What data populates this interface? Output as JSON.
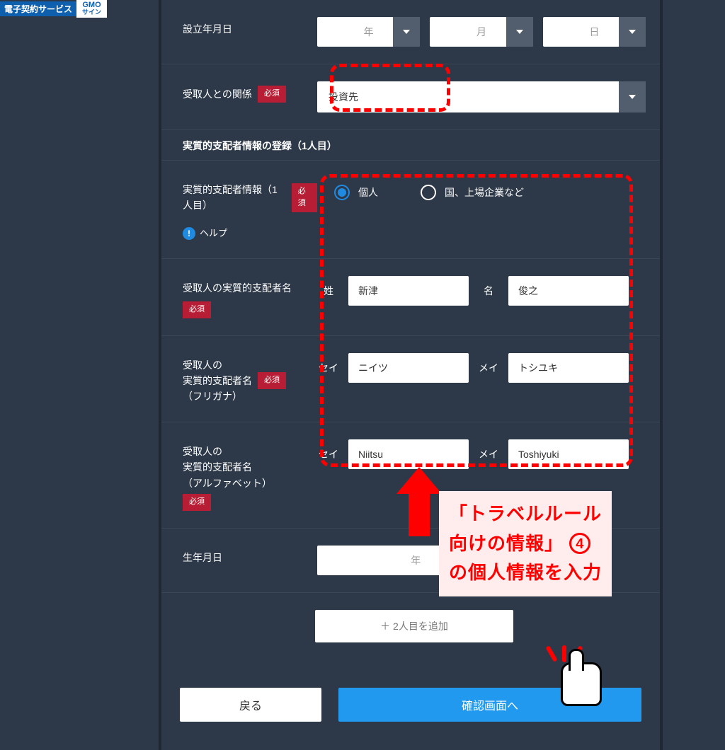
{
  "badge": {
    "service": "電子契約サービス",
    "logo_top": "GMO",
    "logo_sub": "サイン"
  },
  "required_label": "必須",
  "rows": {
    "establishment": {
      "label": "設立年月日",
      "year": "年",
      "month": "月",
      "day": "日"
    },
    "relationship": {
      "label": "受取人との関係",
      "value": "投資先"
    },
    "section_header": "実質的支配者情報の登録（1人目）",
    "type": {
      "label": "実質的支配者情報（1人目）",
      "help": "ヘルプ",
      "options": {
        "individual": "個人",
        "corporate": "国、上場企業など"
      },
      "selected": "individual"
    },
    "name_kanji": {
      "label": "受取人の実質的支配者名",
      "sei_label": "姓",
      "sei_value": "新津",
      "mei_label": "名",
      "mei_value": "俊之"
    },
    "name_kana": {
      "label": "受取人の\n実質的支配者名\n（フリガナ）",
      "sei_label": "セイ",
      "sei_value": "ニイツ",
      "mei_label": "メイ",
      "mei_value": "トシユキ"
    },
    "name_alpha": {
      "label": "受取人の\n実質的支配者名\n（アルファベット）",
      "sei_label": "セイ",
      "sei_value": "Niitsu",
      "mei_label": "メイ",
      "mei_value": "Toshiyuki"
    },
    "birthdate": {
      "label": "生年月日",
      "year": "年"
    },
    "add_second": "＋ 2人目を追加"
  },
  "buttons": {
    "back": "戻る",
    "confirm": "確認画面へ"
  },
  "hint": {
    "line1_prefix": "「トラベルルール",
    "line2_prefix": "向けの情報」",
    "number": "4",
    "line3": "の個人情報を入力"
  }
}
